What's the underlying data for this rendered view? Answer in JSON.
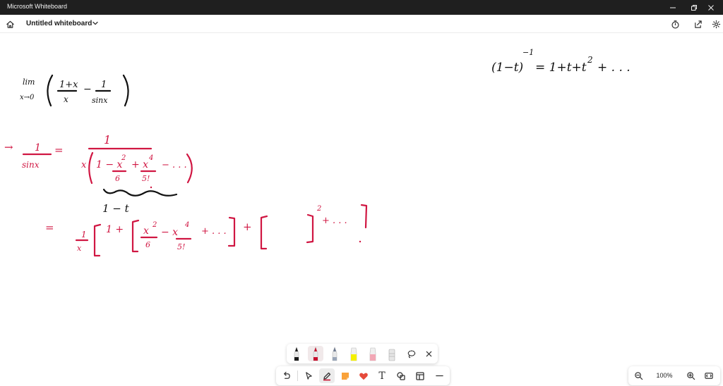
{
  "window": {
    "app_title": "Microsoft Whiteboard",
    "minimize_icon": "minimize-icon",
    "restore_icon": "restore-icon",
    "close_icon": "close-icon"
  },
  "header": {
    "board_title": "Untitled whiteboard",
    "icons": [
      "home-icon",
      "chevron-down-icon",
      "timer-icon",
      "share-icon",
      "settings-icon"
    ]
  },
  "ink": {
    "colors": {
      "black": "#111111",
      "red": "#d01642"
    },
    "black_notes": {
      "lim_word": "lim",
      "lim_sub": "x→0",
      "expr_num_left": "1+x",
      "expr_den_left": "x",
      "minus": "−",
      "expr_num_right": "1",
      "expr_den_right": "sinx",
      "series_left": "(1−t)",
      "series_exp": "−1",
      "series_eq": "= 1+t+t",
      "series_sq": "2",
      "series_tail": "+ . . ."
    },
    "red_notes": {
      "arrow": "→",
      "frac_num": "1",
      "frac_den": "sinx",
      "eq1": "=",
      "big_num": "1",
      "x_prefix": "x",
      "term_a": "1 − x",
      "term_a_exp": "2",
      "term_a_den": "6",
      "term_b": "+ x",
      "term_b_exp": "4",
      "term_b_den": "5!",
      "term_tail": "− . . .",
      "eq2": "=",
      "one_over_x_num": "1",
      "one_over_x_den": "x",
      "open1": "1 +",
      "x2": "x",
      "x2_exp": "2",
      "x2_den": "6",
      "minus_x4": "− x",
      "x4_exp": "4",
      "x4_den": "5!",
      "plus_dots": "+ . . .",
      "plus": "+",
      "sq_exp": "2",
      "plus_dots2": "+ . . ."
    },
    "black_under": "1 − t"
  },
  "pen_tray": {
    "pens": [
      {
        "name": "black-pen",
        "color": "#1a1a1a",
        "selected": false
      },
      {
        "name": "red-pen",
        "color": "#c8102e",
        "selected": true
      },
      {
        "name": "blue-pen",
        "color": "#9aa6b8",
        "selected": false
      },
      {
        "name": "yellow-highlighter",
        "color": "#f4f000",
        "selected": false
      },
      {
        "name": "pink-highlighter",
        "color": "#f2a7b5",
        "selected": false
      },
      {
        "name": "eraser",
        "color": "#d9d9d9",
        "selected": false
      }
    ],
    "icons": [
      "lasso-icon",
      "close-icon"
    ]
  },
  "main_toolbar": {
    "tools": [
      "undo-icon",
      "select-icon",
      "pen-icon",
      "sticky-note-icon",
      "reaction-heart-icon",
      "text-icon",
      "shapes-icon",
      "template-icon",
      "more-icon"
    ],
    "text_tool_label": "T"
  },
  "zoom": {
    "level": "100%",
    "icons": [
      "zoom-out-icon",
      "zoom-in-icon",
      "fit-to-screen-icon"
    ]
  }
}
